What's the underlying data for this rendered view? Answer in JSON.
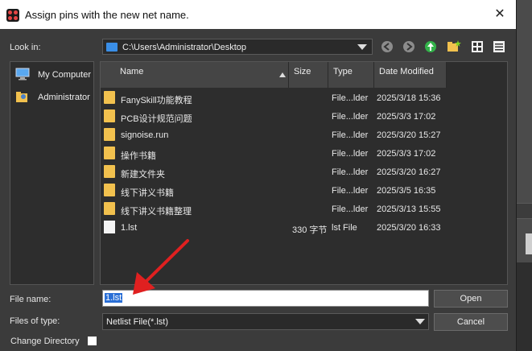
{
  "dialog": {
    "title": "Assign pins with the new net name.",
    "close_glyph": "✕"
  },
  "lookin": {
    "label": "Look in:",
    "path": "C:\\Users\\Administrator\\Desktop"
  },
  "toolbar": {
    "icons": [
      "back-icon",
      "forward-icon",
      "parent-dir-icon",
      "new-folder-icon",
      "list-view-icon",
      "detail-view-icon"
    ]
  },
  "sidebar": {
    "items": [
      {
        "label": "My Computer",
        "icon": "computer-icon"
      },
      {
        "label": "Administrator",
        "icon": "user-folder-icon"
      }
    ]
  },
  "filelist": {
    "headers": {
      "name": "Name",
      "size": "Size",
      "type": "Type",
      "date": "Date Modified"
    },
    "rows": [
      {
        "name": "FanySkill功能教程",
        "size": "",
        "type": "File...lder",
        "date": "2025/3/18 15:36",
        "kind": "folder"
      },
      {
        "name": "PCB设计规范问题",
        "size": "",
        "type": "File...lder",
        "date": "2025/3/3 17:02",
        "kind": "folder"
      },
      {
        "name": "signoise.run",
        "size": "",
        "type": "File...lder",
        "date": "2025/3/20 15:27",
        "kind": "folder"
      },
      {
        "name": "操作书籍",
        "size": "",
        "type": "File...lder",
        "date": "2025/3/3 17:02",
        "kind": "folder"
      },
      {
        "name": "新建文件夹",
        "size": "",
        "type": "File...lder",
        "date": "2025/3/20 16:27",
        "kind": "folder"
      },
      {
        "name": "线下讲义书籍",
        "size": "",
        "type": "File...lder",
        "date": "2025/3/5 16:35",
        "kind": "folder"
      },
      {
        "name": "线下讲义书籍整理",
        "size": "",
        "type": "File...lder",
        "date": "2025/3/13 15:55",
        "kind": "folder"
      },
      {
        "name": "1.lst",
        "size": "330 字节",
        "type": "lst File",
        "date": "2025/3/20 16:33",
        "kind": "file"
      }
    ]
  },
  "filename": {
    "label": "File name:",
    "value": "1.lst"
  },
  "filetype": {
    "label": "Files of type:",
    "value": "Netlist File(*.lst)"
  },
  "buttons": {
    "open": "Open",
    "cancel": "Cancel"
  },
  "change_dir": {
    "label": "Change Directory",
    "checked": false
  },
  "colors": {
    "dialog_bg": "#3b3b3b",
    "folder": "#f2c14e",
    "selection": "#2a6fd6",
    "annotation_arrow": "#e02020"
  }
}
